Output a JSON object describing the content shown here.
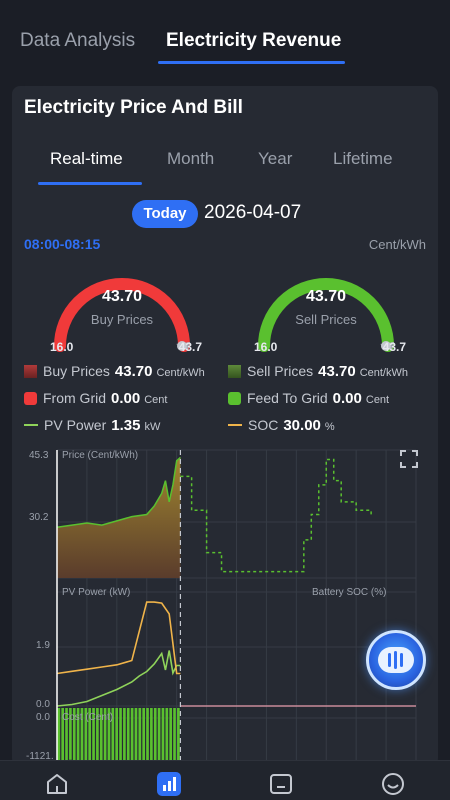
{
  "top_tabs": [
    {
      "label": "Data Analysis",
      "active": false
    },
    {
      "label": "Electricity Revenue",
      "active": true
    }
  ],
  "card": {
    "title": "Electricity Price And Bill",
    "period_tabs": [
      "Real-time",
      "Month",
      "Year",
      "Lifetime"
    ],
    "active_period": "Real-time",
    "today_label": "Today",
    "date": "2026-04-07",
    "time_range": "08:00-08:15",
    "unit": "Cent/kWh"
  },
  "gauges": {
    "buy": {
      "value": "43.70",
      "label": "Buy Prices",
      "min": "16.0",
      "max": "43.7",
      "color": "#f03a3a"
    },
    "sell": {
      "value": "43.70",
      "label": "Sell Prices",
      "min": "16.0",
      "max": "43.7",
      "color": "#5ac02f"
    }
  },
  "legend": {
    "buy_prices": {
      "label": "Buy Prices",
      "value": "43.70",
      "unit": "Cent/kWh"
    },
    "sell_prices": {
      "label": "Sell Prices",
      "value": "43.70",
      "unit": "Cent/kWh"
    },
    "from_grid": {
      "label": "From Grid",
      "value": "0.00",
      "unit": "Cent"
    },
    "feed_to_grid": {
      "label": "Feed To Grid",
      "value": "0.00",
      "unit": "Cent"
    },
    "pv_power": {
      "label": "PV Power",
      "value": "1.35",
      "unit": "kW"
    },
    "soc": {
      "label": "SOC",
      "value": "30.00",
      "unit": "%"
    }
  },
  "colors": {
    "accent": "#2f6ff4",
    "buy": "#f03a3a",
    "sell": "#5ac02f",
    "pv": "#8fd35a",
    "soc": "#f0b44a"
  },
  "chart_data": [
    {
      "type": "area",
      "ylabel": "Price (Cent/kWh)",
      "y_ticks": [
        "45.3",
        "30.2"
      ],
      "ylim": [
        16.0,
        45.3
      ],
      "series": [
        {
          "name": "Buy Prices",
          "x_hours": [
            0,
            1,
            2,
            3,
            4,
            5,
            6,
            6.5,
            7,
            7.25,
            7.5,
            7.75,
            8.0,
            8.25
          ],
          "values": [
            28.0,
            28.5,
            29.0,
            28.5,
            29.5,
            30.5,
            31.0,
            33.0,
            36.0,
            39.0,
            34.0,
            38.0,
            43.7,
            44.5
          ]
        },
        {
          "name": "Sell Prices",
          "x_hours": [
            8.25,
            9,
            10,
            11,
            12,
            13,
            14,
            15,
            16,
            16.5,
            17,
            17.5,
            18,
            18.5,
            19,
            20,
            21
          ],
          "values": [
            40.0,
            32.0,
            22.0,
            17.5,
            17.5,
            17.5,
            17.5,
            17.5,
            17.5,
            25.0,
            31.0,
            38.0,
            44.0,
            39.0,
            34.0,
            32.0,
            30.5
          ]
        }
      ]
    },
    {
      "type": "line",
      "ylabel": "PV Power (kW)",
      "right_label": "Battery SOC (%)",
      "y_ticks": [
        "1.9",
        "0.0"
      ],
      "series": [
        {
          "name": "PV Power",
          "x_hours": [
            0,
            1,
            2,
            3,
            4,
            5,
            5.5,
            6,
            6.5,
            7,
            7.25,
            7.5,
            7.75,
            8.0,
            8.25
          ],
          "values": [
            0.0,
            0.05,
            0.15,
            0.35,
            0.55,
            0.8,
            1.0,
            1.15,
            1.4,
            1.75,
            1.2,
            1.85,
            1.1,
            1.35,
            1.35
          ]
        },
        {
          "name": "SOC",
          "x_hours": [
            0,
            1,
            2,
            3,
            4,
            5,
            6,
            6.5,
            7,
            7.5,
            8,
            8.25
          ],
          "values": [
            30,
            32,
            34,
            36,
            38,
            42,
            96,
            96,
            95,
            85,
            30,
            30
          ]
        }
      ]
    },
    {
      "type": "bar",
      "ylabel": "Cost (Cent)",
      "y_ticks": [
        "0.0",
        "-1121."
      ],
      "values": [
        -1121,
        -1121,
        -1121,
        -1000,
        -1121,
        -1121,
        -1121,
        -1121,
        -1121,
        -1121,
        -1121,
        -1121,
        -1121,
        -1121,
        -1121,
        -1121,
        -1121,
        -1121,
        -1121,
        -1121,
        -1121,
        -1121,
        -1121,
        -1121,
        -1121,
        -1121,
        -1121,
        -1121,
        -1121,
        -1121,
        -1121,
        -1121
      ]
    }
  ],
  "nav": [
    {
      "icon": "home-icon"
    },
    {
      "icon": "analytics-icon",
      "active": true
    },
    {
      "icon": "device-icon"
    },
    {
      "icon": "profile-icon"
    }
  ]
}
